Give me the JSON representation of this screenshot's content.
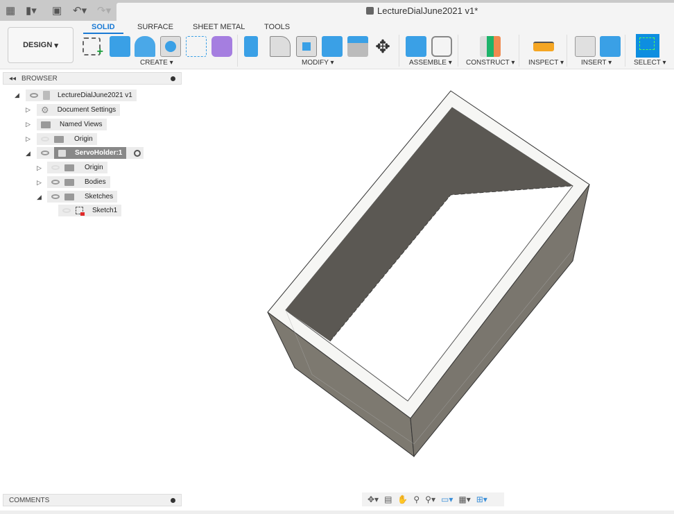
{
  "window": {
    "title": "LectureDialJune2021 v1*"
  },
  "quick_access": [
    "grid-icon",
    "file-icon",
    "save-icon",
    "undo-icon",
    "redo-icon"
  ],
  "workspace": {
    "label": "DESIGN"
  },
  "tabs": [
    {
      "label": "SOLID",
      "active": true
    },
    {
      "label": "SURFACE"
    },
    {
      "label": "SHEET METAL"
    },
    {
      "label": "TOOLS"
    }
  ],
  "groups": [
    {
      "label": "CREATE"
    },
    {
      "label": "MODIFY"
    },
    {
      "label": "ASSEMBLE"
    },
    {
      "label": "CONSTRUCT"
    },
    {
      "label": "INSPECT"
    },
    {
      "label": "INSERT"
    },
    {
      "label": "SELECT"
    }
  ],
  "browser": {
    "title": "BROWSER",
    "items": [
      {
        "label": "LectureDialJune2021 v1"
      },
      {
        "label": "Document Settings"
      },
      {
        "label": "Named Views"
      },
      {
        "label": "Origin"
      },
      {
        "label": "ServoHolder:1"
      },
      {
        "label": "Origin"
      },
      {
        "label": "Bodies"
      },
      {
        "label": "Sketches"
      },
      {
        "label": "Sketch1"
      }
    ]
  },
  "comments": {
    "title": "COMMENTS"
  },
  "colors": {
    "accent": "#1a7ad4",
    "select_bg": "#0d8ee0",
    "model_dark": "#5b5853",
    "model_side": "#7a766e"
  }
}
